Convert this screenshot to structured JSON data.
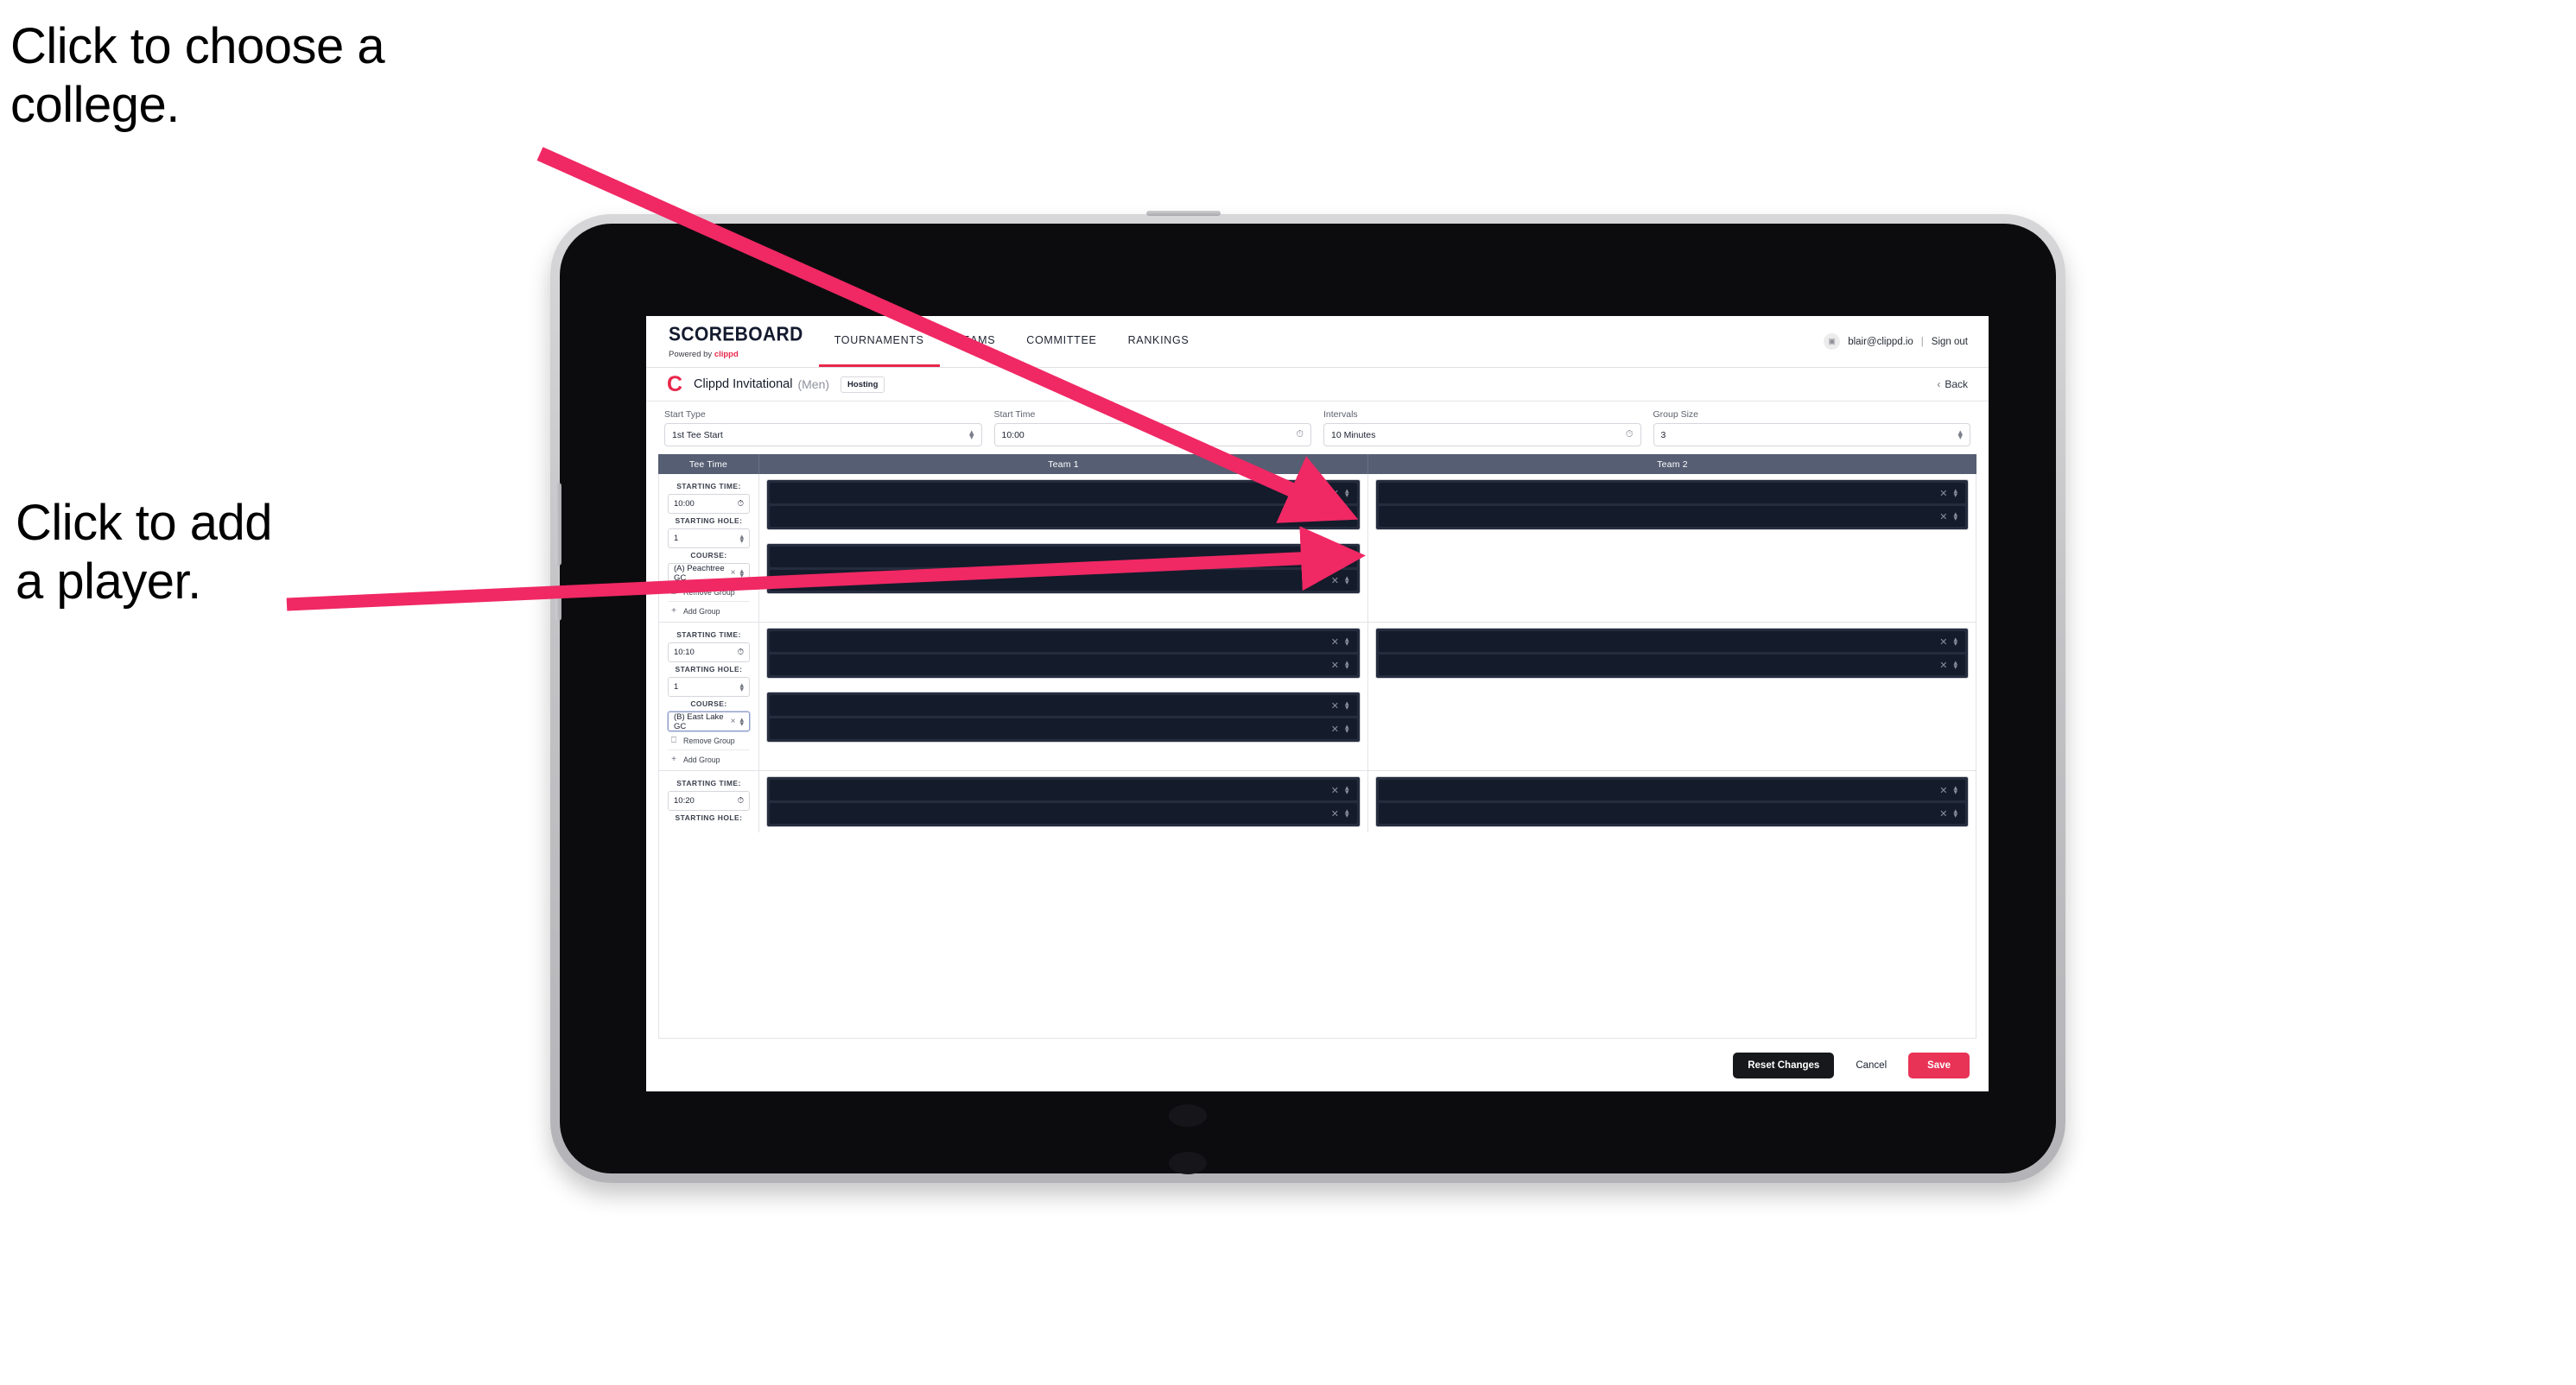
{
  "annotations": [
    {
      "text": "Click to choose a\ncollege."
    },
    {
      "text": "Click to add\na player."
    }
  ],
  "colors": {
    "accent_pink": "#e8274b",
    "annotation_arrow": "#f02864",
    "table_header": "#565e73",
    "slot_fill": "#141b2b",
    "save_button": "#e83357"
  },
  "app": {
    "navbar": {
      "brand_title": "SCOREBOARD",
      "brand_sub_prefix": "Powered by ",
      "brand_sub_name": "clippd",
      "tabs": [
        {
          "label": "TOURNAMENTS",
          "active": true
        },
        {
          "label": "TEAMS",
          "active": false
        },
        {
          "label": "COMMITTEE",
          "active": false
        },
        {
          "label": "RANKINGS",
          "active": false
        }
      ],
      "avatar_glyph": "▣",
      "email": "blair@clippd.io",
      "separator": "|",
      "sign_out": "Sign out"
    },
    "tournament_bar": {
      "logo_letter": "C",
      "name": "Clippd Invitational",
      "gender": "(Men)",
      "badge": "Hosting",
      "back_chevron": "‹",
      "back_label": "Back"
    },
    "settings": [
      {
        "label": "Start Type",
        "value": "1st Tee Start",
        "adorn": "stepper"
      },
      {
        "label": "Start Time",
        "value": "10:00",
        "adorn": "clock"
      },
      {
        "label": "Intervals",
        "value": "10 Minutes",
        "adorn": "clock"
      },
      {
        "label": "Group Size",
        "value": "3",
        "adorn": "stepper"
      }
    ],
    "table": {
      "headers": [
        "Tee Time",
        "Team 1",
        "Team 2"
      ],
      "labels": {
        "starting_time": "STARTING TIME:",
        "starting_hole": "STARTING HOLE:",
        "course": "COURSE:",
        "remove_group": "Remove Group",
        "add_group": "Add Group",
        "remove_icon": "⌧",
        "add_icon": "+",
        "clock_icon": "◴",
        "clear_icon": "×"
      },
      "groups": [
        {
          "starting_time": "10:00",
          "starting_hole": "1",
          "course": "(A) Peachtree GC",
          "course_focused": false,
          "team1_stacks": [
            {
              "slots": 2
            },
            {
              "slots": 2
            }
          ],
          "team2_stacks": [
            {
              "slots": 2
            }
          ]
        },
        {
          "starting_time": "10:10",
          "starting_hole": "1",
          "course": "(B) East Lake GC",
          "course_focused": true,
          "team1_stacks": [
            {
              "slots": 2
            },
            {
              "slots": 2
            }
          ],
          "team2_stacks": [
            {
              "slots": 2
            }
          ]
        },
        {
          "starting_time": "10:20",
          "starting_hole": "",
          "course": "",
          "course_focused": false,
          "team1_stacks": [
            {
              "slots": 2
            }
          ],
          "team2_stacks": [
            {
              "slots": 2
            }
          ]
        }
      ]
    },
    "footer": {
      "reset": "Reset Changes",
      "cancel": "Cancel",
      "save": "Save"
    }
  }
}
